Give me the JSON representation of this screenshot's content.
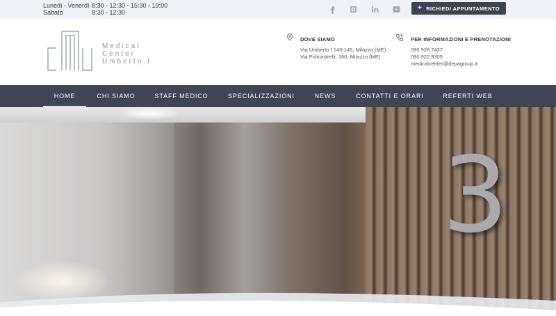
{
  "topbar": {
    "hours": [
      {
        "day": "Lunedì - Venerdì",
        "time": "8:30 - 12:30 - 15:30 - 19:00"
      },
      {
        "day": "Sabato",
        "time": "8:30 - 12:30"
      }
    ],
    "social_icons": [
      "facebook-icon",
      "instagram-icon",
      "linkedin-icon",
      "youtube-icon"
    ],
    "cta_label": "RICHIEDI APPUNTAMENTO"
  },
  "header": {
    "logo_lines": [
      "Medical",
      "Center",
      "Umberto I"
    ],
    "location": {
      "icon": "map-pin-icon",
      "title": "DOVE SIAMO",
      "lines": [
        "Via Umberto I 143-145, Milazzo (ME)",
        "Via Policastrelli, 160, Milazzo (ME)"
      ]
    },
    "contacts": {
      "icon": "phone-icon",
      "title": "PER INFORMAZIONI E PRENOTAZIONI",
      "lines": [
        "090 928 7437",
        "090 922 9305",
        "medicalcenter@depagroup.it"
      ]
    }
  },
  "nav": {
    "items": [
      {
        "label": "HOME",
        "active": true
      },
      {
        "label": "CHI SIAMO",
        "active": false
      },
      {
        "label": "STAFF MEDICO",
        "active": false
      },
      {
        "label": "SPECIALIZZAZIONI",
        "active": false
      },
      {
        "label": "NEWS",
        "active": false
      },
      {
        "label": "CONTATTI E ORARI",
        "active": false
      },
      {
        "label": "REFERTI WEB",
        "active": false
      }
    ]
  },
  "hero": {
    "numeral": "3"
  },
  "colors": {
    "topbar_bg": "#eef1f5",
    "nav_bg": "#3f4653",
    "cta_bg": "#3d4451",
    "logo_gray": "#8d949c"
  }
}
